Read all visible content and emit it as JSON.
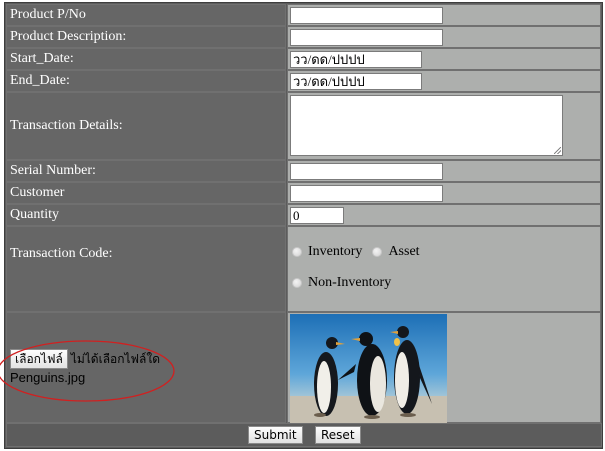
{
  "fields": {
    "product_pno": {
      "label": "Product P/No",
      "value": ""
    },
    "product_description": {
      "label": "Product Description:",
      "value": ""
    },
    "start_date": {
      "label": "Start_Date:",
      "value": "วว/ดด/ปปปป"
    },
    "end_date": {
      "label": "End_Date:",
      "value": "วว/ดด/ปปปป"
    },
    "transaction_details": {
      "label": "Transaction Details:",
      "value": ""
    },
    "serial_number": {
      "label": "Serial Number:",
      "value": ""
    },
    "customer": {
      "label": "Customer",
      "value": ""
    },
    "quantity": {
      "label": "Quantity",
      "value": "0"
    }
  },
  "transaction_code": {
    "label": "Transaction Code:",
    "options": [
      "Inventory",
      "Asset",
      "Non-Inventory"
    ]
  },
  "file_upload": {
    "button_label": "เลือกไฟล์",
    "status": "ไม่ได้เลือกไฟล์ใด",
    "file_name": "Penguins.jpg"
  },
  "preview_image": {
    "icon": "penguins-photo",
    "colors": {
      "sky": "#2a7fc4",
      "ice": "#c9c3b6"
    }
  },
  "buttons": {
    "submit": "Submit",
    "reset": "Reset"
  },
  "colors": {
    "label_cell": "#666666",
    "input_cell": "#adafad",
    "annotation": "#d12020"
  }
}
